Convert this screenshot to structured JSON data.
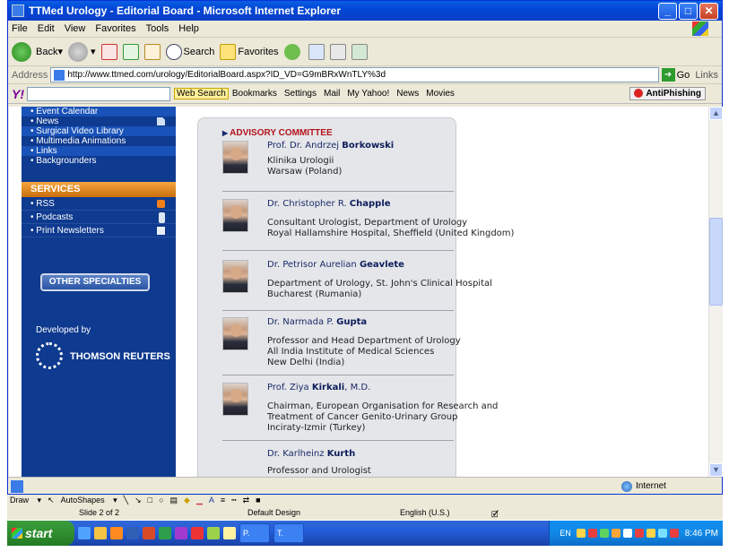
{
  "window": {
    "title": "TTMed Urology - Editorial Board - Microsoft Internet Explorer",
    "minimize": "_",
    "maximize": "□",
    "close": "✕"
  },
  "menu": [
    "File",
    "Edit",
    "View",
    "Favorites",
    "Tools",
    "Help"
  ],
  "toolbar": {
    "back": "Back",
    "search": "Search",
    "favorites": "Favorites"
  },
  "address": {
    "label": "Address",
    "url": "http://www.ttmed.com/urology/EditorialBoard.aspx?ID_VD=G9mBRxWnTLY%3d",
    "go": "Go",
    "links": "Links"
  },
  "yahoo_bar": {
    "logo": "Y!",
    "web_search": "Web Search",
    "bookmarks": "Bookmarks",
    "settings": "Settings",
    "mail": "Mail",
    "my_yahoo": "My Yahoo!",
    "news": "News",
    "movies": "Movies",
    "antiphishing": "AntiPhishing"
  },
  "sidebar": {
    "items": [
      "Event Calendar",
      "News",
      "Surgical Video Library",
      "Multimedia Animations",
      "Links",
      "Backgrounders"
    ],
    "services_title": "SERVICES",
    "services": [
      "RSS",
      "Podcasts",
      "Print Newsletters"
    ],
    "other_specialties": "OTHER SPECIALTIES",
    "developed_by": "Developed by",
    "partner": "THOMSON REUTERS"
  },
  "content": {
    "section_title": "ADVISORY COMMITTEE",
    "members": [
      {
        "prefix": "Prof. Dr. Andrzej ",
        "surname": "Borkowski",
        "suffix": "",
        "lines": [
          "Klinika Urologii",
          "Warsaw (Poland)"
        ]
      },
      {
        "prefix": "Dr. Christopher R. ",
        "surname": "Chapple",
        "suffix": "",
        "lines": [
          "Consultant Urologist, Department of Urology",
          "Royal Hallamshire Hospital, Sheffield (United Kingdom)"
        ]
      },
      {
        "prefix": "Dr. Petrisor Aurelian ",
        "surname": "Geavlete",
        "suffix": "",
        "lines": [
          "Department of Urology, St. John's Clinical Hospital",
          "Bucharest (Rumania)"
        ]
      },
      {
        "prefix": "Dr. Narmada P. ",
        "surname": "Gupta",
        "suffix": "",
        "lines": [
          "Professor and Head Department of Urology",
          "All India Institute of Medical Sciences",
          "New Delhi (India)"
        ]
      },
      {
        "prefix": "Prof. Ziya ",
        "surname": "Kirkali",
        "suffix": ", M.D.",
        "lines": [
          "Chairman, European Organisation for Research and",
          "Treatment of Cancer Genito-Urinary Group",
          "Inciraty-Izmir (Turkey)"
        ]
      },
      {
        "prefix": "Dr. Karlheinz ",
        "surname": "Kurth",
        "suffix": "",
        "lines": [
          "Professor and Urologist"
        ]
      }
    ]
  },
  "status": {
    "zone": "Internet"
  },
  "drawbar": {
    "draw": "Draw",
    "autoshapes": "AutoShapes"
  },
  "ppt_status": {
    "slide": "Slide 2 of 2",
    "design": "Default Design",
    "lang": "English (U.S.)"
  },
  "taskbar": {
    "start": "start",
    "task1": "P.",
    "task2": "T.",
    "lang": "EN",
    "clock": "8:46 PM"
  }
}
